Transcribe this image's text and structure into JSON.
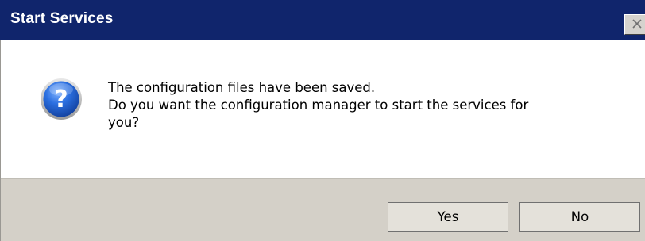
{
  "dialog": {
    "title": "Start Services",
    "icon": "question-icon",
    "message_lines": [
      "The configuration files have been saved.",
      "Do you want the configuration manager to start the services for",
      "you?"
    ],
    "buttons": {
      "yes_label": "Yes",
      "no_label": "No"
    }
  },
  "colors": {
    "titlebar": "#10256c",
    "footer": "#d4d0c8",
    "icon_blue": "#1e5bc6"
  }
}
